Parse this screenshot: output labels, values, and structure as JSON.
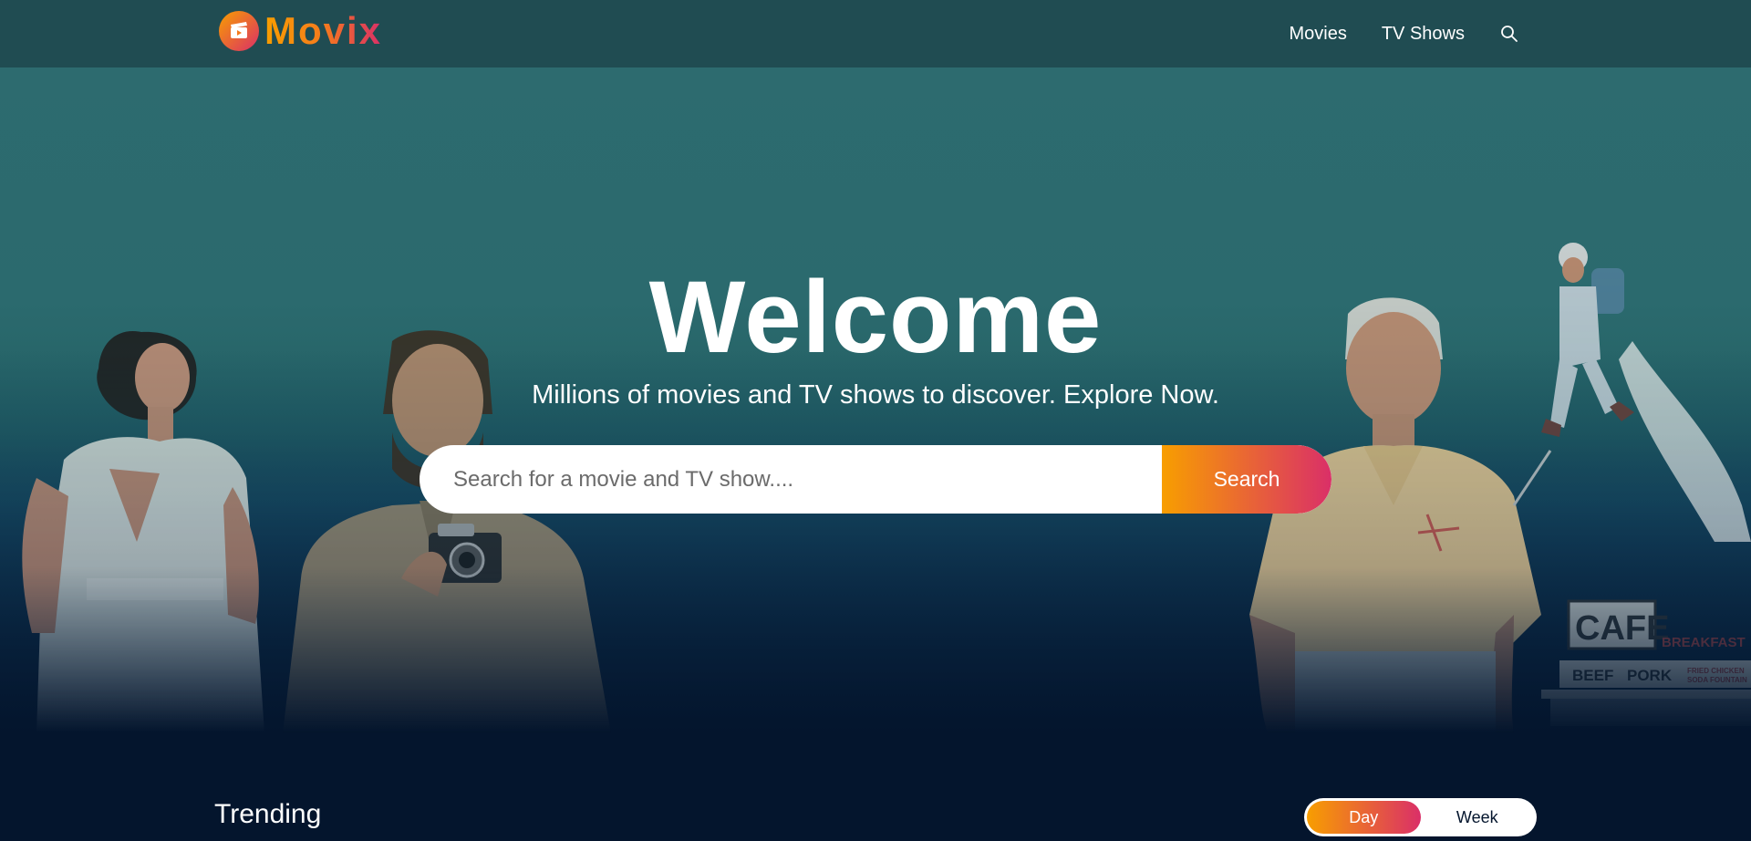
{
  "header": {
    "logo_text": "Movix",
    "nav": [
      {
        "label": "Movies"
      },
      {
        "label": "TV Shows"
      }
    ],
    "search_icon": "search-icon"
  },
  "hero": {
    "title": "Welcome",
    "subtitle": "Millions of movies and TV shows to discover. Explore Now.",
    "search": {
      "placeholder": "Search for a movie and TV show....",
      "value": "",
      "button_label": "Search"
    },
    "background_sign_text": [
      "CAFE",
      "BREAKFAST",
      "BEEF",
      "PORK",
      "FRIED CHICKEN",
      "SODA FOUNTAIN"
    ]
  },
  "trending": {
    "title": "Trending",
    "tabs": [
      {
        "label": "Day",
        "active": true
      },
      {
        "label": "Week",
        "active": false
      }
    ]
  },
  "colors": {
    "header_bg": "#204c52",
    "page_bg": "#04152d",
    "gradient_start": "#f89e00",
    "gradient_end": "#da2f68"
  }
}
